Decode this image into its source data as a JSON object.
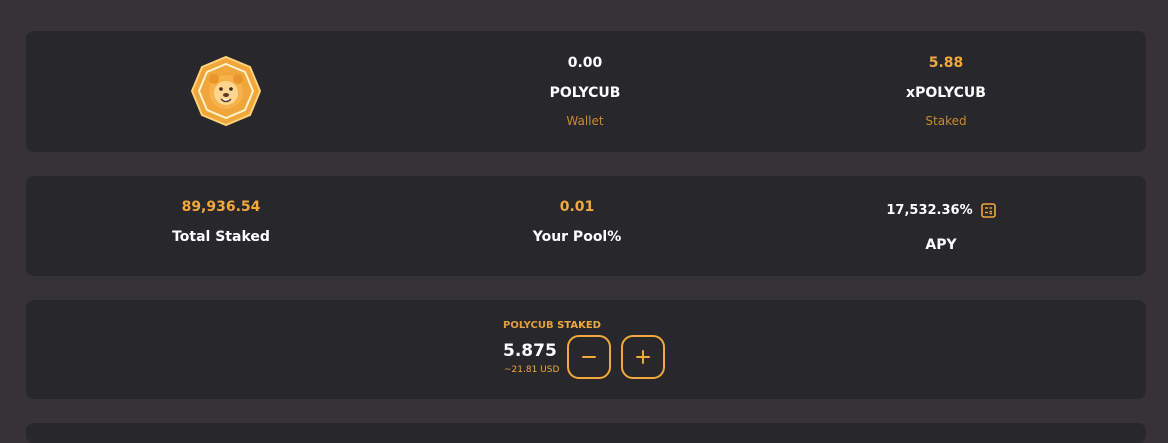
{
  "balances": {
    "wallet": {
      "amount": "0.00",
      "token": "POLYCUB",
      "label": "Wallet"
    },
    "staked": {
      "amount": "5.88",
      "token": "xPOLYCUB",
      "label": "Staked"
    }
  },
  "stats": {
    "total_staked": {
      "value": "89,936.54",
      "label": "Total Staked"
    },
    "your_pool": {
      "value": "0.01",
      "label": "Your Pool%"
    },
    "apy": {
      "value": "17,532.36%",
      "label": "APY",
      "icon": "calculator-icon"
    }
  },
  "stake": {
    "title_token": "POLYCUB",
    "title_word": "STAKED",
    "amount": "5.875",
    "usd": "~21.81 USD",
    "minus_icon": "minus-icon",
    "plus_icon": "plus-icon"
  },
  "colors": {
    "background": "#353336",
    "card": "#28272c",
    "accent": "#f2a93b",
    "muted_accent": "#c98a2e"
  }
}
